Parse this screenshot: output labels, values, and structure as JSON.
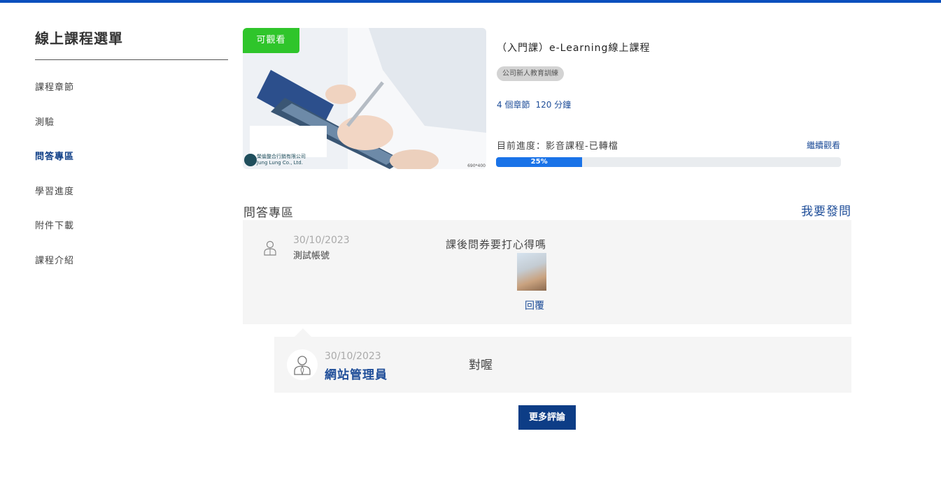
{
  "colors": {
    "accent": "#0d3d86",
    "link": "#1f4e99",
    "top_bar": "#0b4fbd",
    "badge_green": "#2fc52b",
    "progress_blue": "#1a73e8"
  },
  "sidebar": {
    "title": "線上課程選單",
    "items": [
      {
        "label": "課程章節"
      },
      {
        "label": "測驗"
      },
      {
        "label": "問答專區"
      },
      {
        "label": "學習進度"
      },
      {
        "label": "附件下載"
      },
      {
        "label": "課程介紹"
      }
    ],
    "active_item": "問答專區"
  },
  "course": {
    "badge": "可觀看",
    "image_caption_line1": "榮倫整合行銷有限公司",
    "image_caption_line2": "Jung Lung Co., Ltd.",
    "image_size_label": "690*400",
    "title": "（入門課）e-Learning線上課程",
    "category": "公司新人教育訓練",
    "chapters": "4 個章節",
    "duration": "120 分鐘",
    "progress_label": "目前進度：影音課程-已轉檔",
    "continue_label": "繼續觀看",
    "progress_text": "25%",
    "progress_percent": 25
  },
  "qa": {
    "heading": "問答專區",
    "ask_label": "我要發問",
    "question": {
      "date": "30/10/2023",
      "user": "測試帳號",
      "text": "課後問券要打心得嗎",
      "reply_label": "回覆",
      "user_icon": "user-icon",
      "attachment": "attachment-thumbnail"
    },
    "reply": {
      "date": "30/10/2023",
      "user": "網站管理員",
      "text": "對喔",
      "avatar_icon": "admin-avatar-icon"
    },
    "more_label": "更多評論"
  }
}
